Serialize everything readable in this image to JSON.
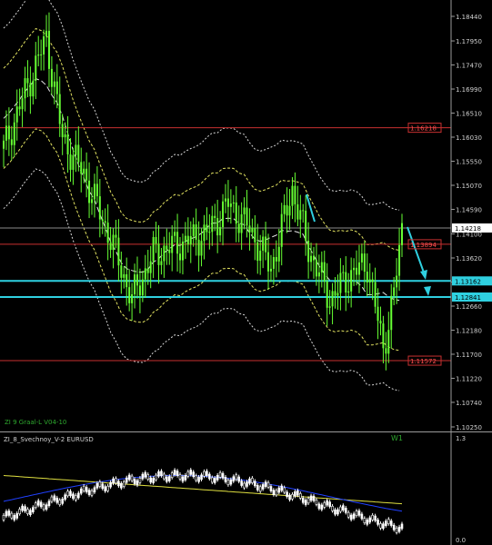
{
  "chart_data": [
    {
      "type": "candlestick",
      "symbol": "EURUSD",
      "timeframe": "W1",
      "indicator_label": "ZI 9 Graal-L V04-10",
      "price_axis_ticks": [
        1.1844,
        1.1795,
        1.1747,
        1.1699,
        1.1651,
        1.1603,
        1.1555,
        1.1507,
        1.1459,
        1.141,
        1.1362,
        1.1314,
        1.1266,
        1.1218,
        1.117,
        1.1122,
        1.1074,
        1.1025
      ],
      "ylim": [
        1.101,
        1.187
      ],
      "level_lines": [
        {
          "label": "1.16218",
          "value": 1.16218,
          "color": "#c83030"
        },
        {
          "label": "1.13894",
          "value": 1.13894,
          "color": "#c83030"
        },
        {
          "label": "1.11572",
          "value": 1.11572,
          "color": "#c83030"
        }
      ],
      "highlight_levels": [
        {
          "label": "1.13162",
          "value": 1.13162,
          "color": "#2fd0e0"
        },
        {
          "label": "1.12841",
          "value": 1.12841,
          "color": "#2fd0e0"
        }
      ],
      "current_price": {
        "label": "1.14218",
        "value": 1.14218
      },
      "candle_color": "#66ff33",
      "grid": true
    },
    {
      "type": "oscillator",
      "name": "ZI_8_Svechnoy_V-2 EURUSD",
      "axis_ticks": [
        "1.3",
        "0.0"
      ],
      "series": [
        {
          "color": "#e0e040"
        },
        {
          "color": "#2040ff"
        }
      ]
    }
  ]
}
